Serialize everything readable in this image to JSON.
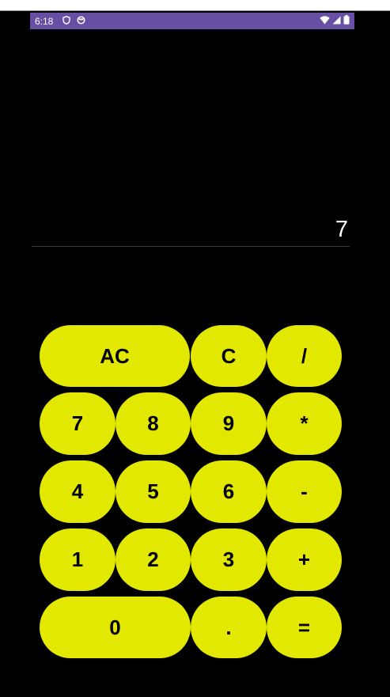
{
  "status_bar": {
    "time": "6:18",
    "icons": [
      "shield-icon",
      "notification-icon",
      "wifi-icon",
      "signal-icon",
      "battery-icon"
    ],
    "color": "#6750a4"
  },
  "display": {
    "value": "7"
  },
  "theme": {
    "background": "#000000",
    "key_color": "#e3e800",
    "key_text_color": "#000000"
  },
  "keys": {
    "ac": "AC",
    "c": "C",
    "divide": "/",
    "seven": "7",
    "eight": "8",
    "nine": "9",
    "multiply": "*",
    "four": "4",
    "five": "5",
    "six": "6",
    "minus": "-",
    "one": "1",
    "two": "2",
    "three": "3",
    "plus": "+",
    "zero": "0",
    "dot": ".",
    "equals": "="
  }
}
